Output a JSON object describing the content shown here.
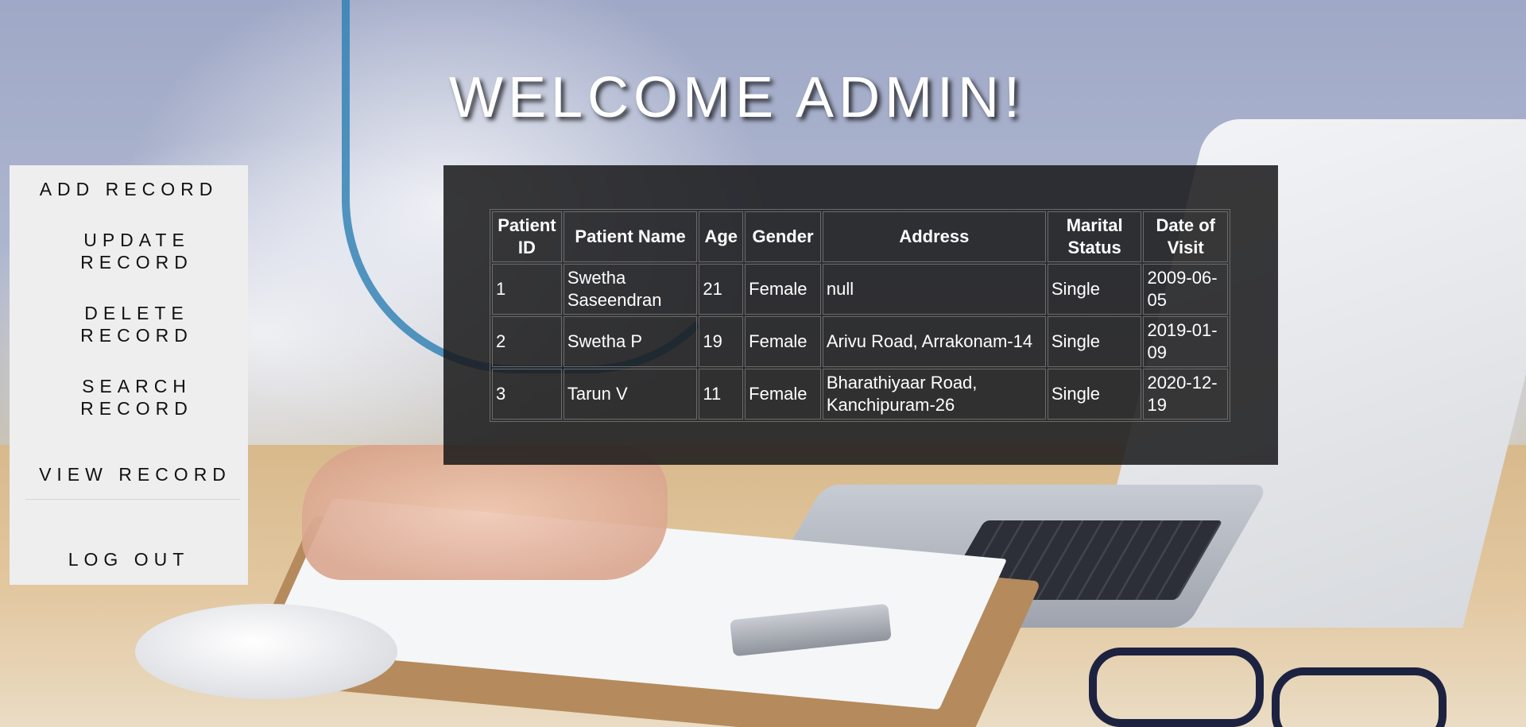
{
  "page": {
    "title": "WELCOME ADMIN!"
  },
  "sidebar": {
    "items": [
      {
        "label": "ADD RECORD"
      },
      {
        "label": "UPDATE RECORD"
      },
      {
        "label": "DELETE RECORD"
      },
      {
        "label": "SEARCH RECORD"
      },
      {
        "label": "VIEW RECORD"
      },
      {
        "label": "LOG OUT"
      }
    ]
  },
  "table": {
    "headers": [
      "Patient ID",
      "Patient Name",
      "Age",
      "Gender",
      "Address",
      "Marital Status",
      "Date of Visit"
    ],
    "rows": [
      [
        "1",
        "Swetha Saseendran",
        "21",
        "Female",
        "null",
        "Single",
        "2009-06-05"
      ],
      [
        "2",
        "Swetha P",
        "19",
        "Female",
        "Arivu Road, Arrakonam-14",
        "Single",
        "2019-01-09"
      ],
      [
        "3",
        "Tarun V",
        "11",
        "Female",
        "Bharathiyaar Road, Kanchipuram-26",
        "Single",
        "2020-12-19"
      ]
    ]
  },
  "colors": {
    "sidebar_bg": "#eeeeee",
    "panel_bg": "#18181a",
    "title_text": "#ffffff"
  }
}
